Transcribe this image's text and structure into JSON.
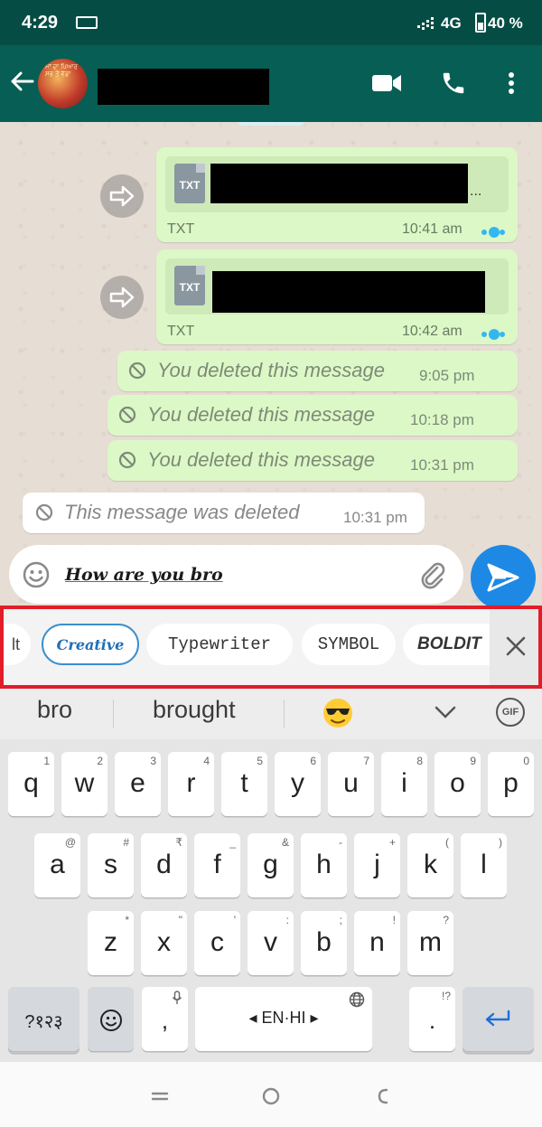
{
  "status_bar": {
    "time": "4:29",
    "network": "4G",
    "battery": "40 %"
  },
  "header": {
    "avatar_text": "ਮਾਂ ਦਾ ਪਿਆਰ ਸਭ ਤੋਂ ਵੱਡਾ",
    "icons": [
      "back-arrow-icon",
      "video-call-icon",
      "phone-icon",
      "more-vert-icon"
    ]
  },
  "messages": [
    {
      "type": "document",
      "file_type": "TXT",
      "file_label": "TXT",
      "time": "10:41 am",
      "ellipsis": "...",
      "status": "read"
    },
    {
      "type": "document",
      "file_type": "TXT",
      "file_label": "TXT",
      "time": "10:42 am",
      "status": "read"
    },
    {
      "type": "deleted",
      "direction": "out",
      "text": "You deleted this message",
      "time": "9:05 pm"
    },
    {
      "type": "deleted",
      "direction": "out",
      "text": "You deleted this message",
      "time": "10:18 pm"
    },
    {
      "type": "deleted",
      "direction": "out",
      "text": "You deleted this message",
      "time": "10:31 pm"
    },
    {
      "type": "deleted",
      "direction": "in",
      "text": "This message was deleted",
      "time": "10:31 pm"
    }
  ],
  "composer": {
    "text": "How are you bro"
  },
  "style_strip": {
    "options": [
      "lt",
      "Creative",
      "Typewriter",
      "SYMBOL",
      "BOLDIT"
    ],
    "selected": "Creative"
  },
  "suggestions": [
    "bro",
    "brought"
  ],
  "keyboard": {
    "row1": [
      {
        "k": "q",
        "h": "1"
      },
      {
        "k": "w",
        "h": "2"
      },
      {
        "k": "e",
        "h": "3"
      },
      {
        "k": "r",
        "h": "4"
      },
      {
        "k": "t",
        "h": "5"
      },
      {
        "k": "y",
        "h": "6"
      },
      {
        "k": "u",
        "h": "7"
      },
      {
        "k": "i",
        "h": "8"
      },
      {
        "k": "o",
        "h": "9"
      },
      {
        "k": "p",
        "h": "0"
      }
    ],
    "row2": [
      {
        "k": "a",
        "h": "@"
      },
      {
        "k": "s",
        "h": "#"
      },
      {
        "k": "d",
        "h": "₹"
      },
      {
        "k": "f",
        "h": "_"
      },
      {
        "k": "g",
        "h": "&"
      },
      {
        "k": "h",
        "h": "-"
      },
      {
        "k": "j",
        "h": "+"
      },
      {
        "k": "k",
        "h": "("
      },
      {
        "k": "l",
        "h": ")"
      }
    ],
    "row3": [
      {
        "k": "z",
        "h": "*"
      },
      {
        "k": "x",
        "h": "\""
      },
      {
        "k": "c",
        "h": "'"
      },
      {
        "k": "v",
        "h": ":"
      },
      {
        "k": "b",
        "h": ";"
      },
      {
        "k": "n",
        "h": "!"
      },
      {
        "k": "m",
        "h": "?"
      }
    ],
    "symbols_key": "?१२३",
    "comma_key": ",",
    "space_label": "◂ EN·HI ▸",
    "period_key": ".",
    "period_hint": "!?"
  }
}
